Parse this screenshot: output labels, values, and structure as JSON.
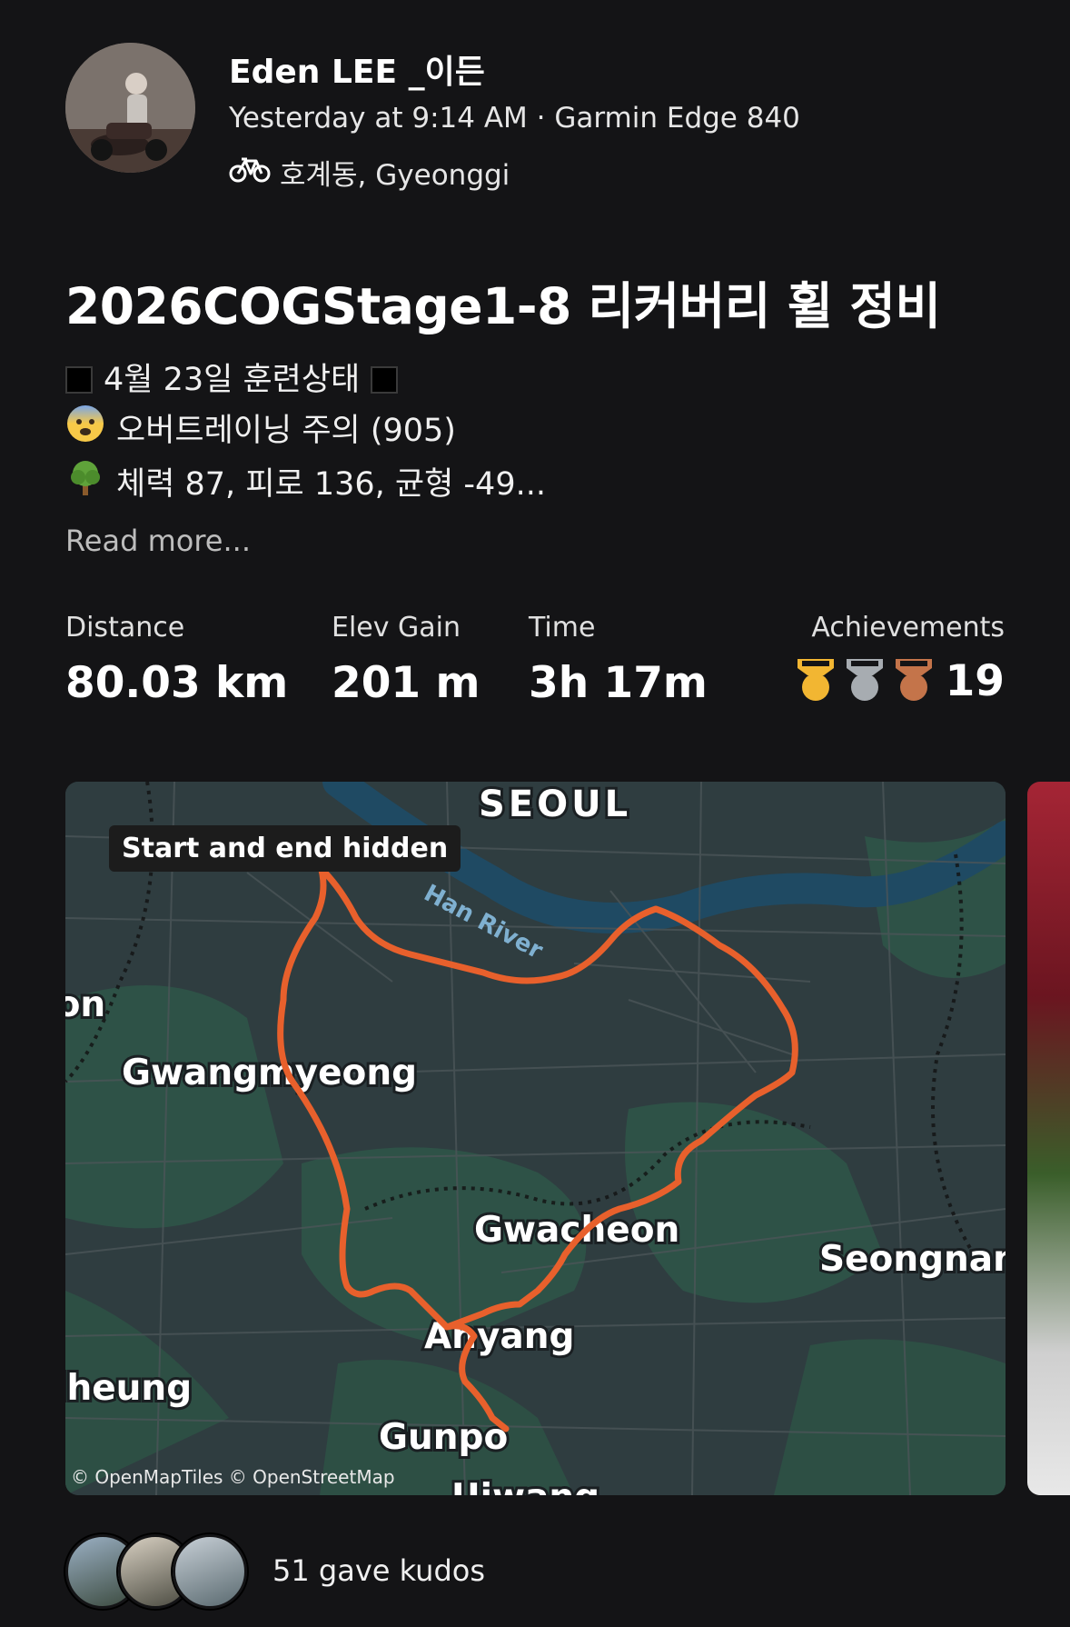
{
  "athlete": {
    "name": "Eden LEE _이든",
    "meta": "Yesterday at 9:14 AM · Garmin Edge 840",
    "location": "호계동, Gyeonggi"
  },
  "activity": {
    "title": "2026COGStage1-8 리커버리 휠 정비",
    "description": [
      "4월 23일 훈련상태",
      "오버트레이닝 주의 (905)",
      "체력 87, 피로 136, 균형 -49..."
    ],
    "read_more": "Read more..."
  },
  "stats": {
    "distance_label": "Distance",
    "distance_value": "80.03 km",
    "elev_label": "Elev Gain",
    "elev_value": "201 m",
    "time_label": "Time",
    "time_value": "3h 17m",
    "achievements_label": "Achievements",
    "achievements_count": "19"
  },
  "map": {
    "badge": "Start and end hidden",
    "attribution": "© OpenMapTiles © OpenStreetMap",
    "labels": [
      "SEOUL",
      "Han River",
      "Gwangmyeong",
      "Gwacheon",
      "Anyang",
      "Gunpo",
      "Seongnam",
      "Siheung",
      "Uiwang",
      "Incheon"
    ],
    "route_color": "#e8602c"
  },
  "kudos": {
    "text": "51 gave kudos"
  },
  "icons": {
    "location": "bike-icon",
    "medals": [
      "gold-medal-icon",
      "silver-medal-icon",
      "bronze-medal-icon"
    ]
  }
}
